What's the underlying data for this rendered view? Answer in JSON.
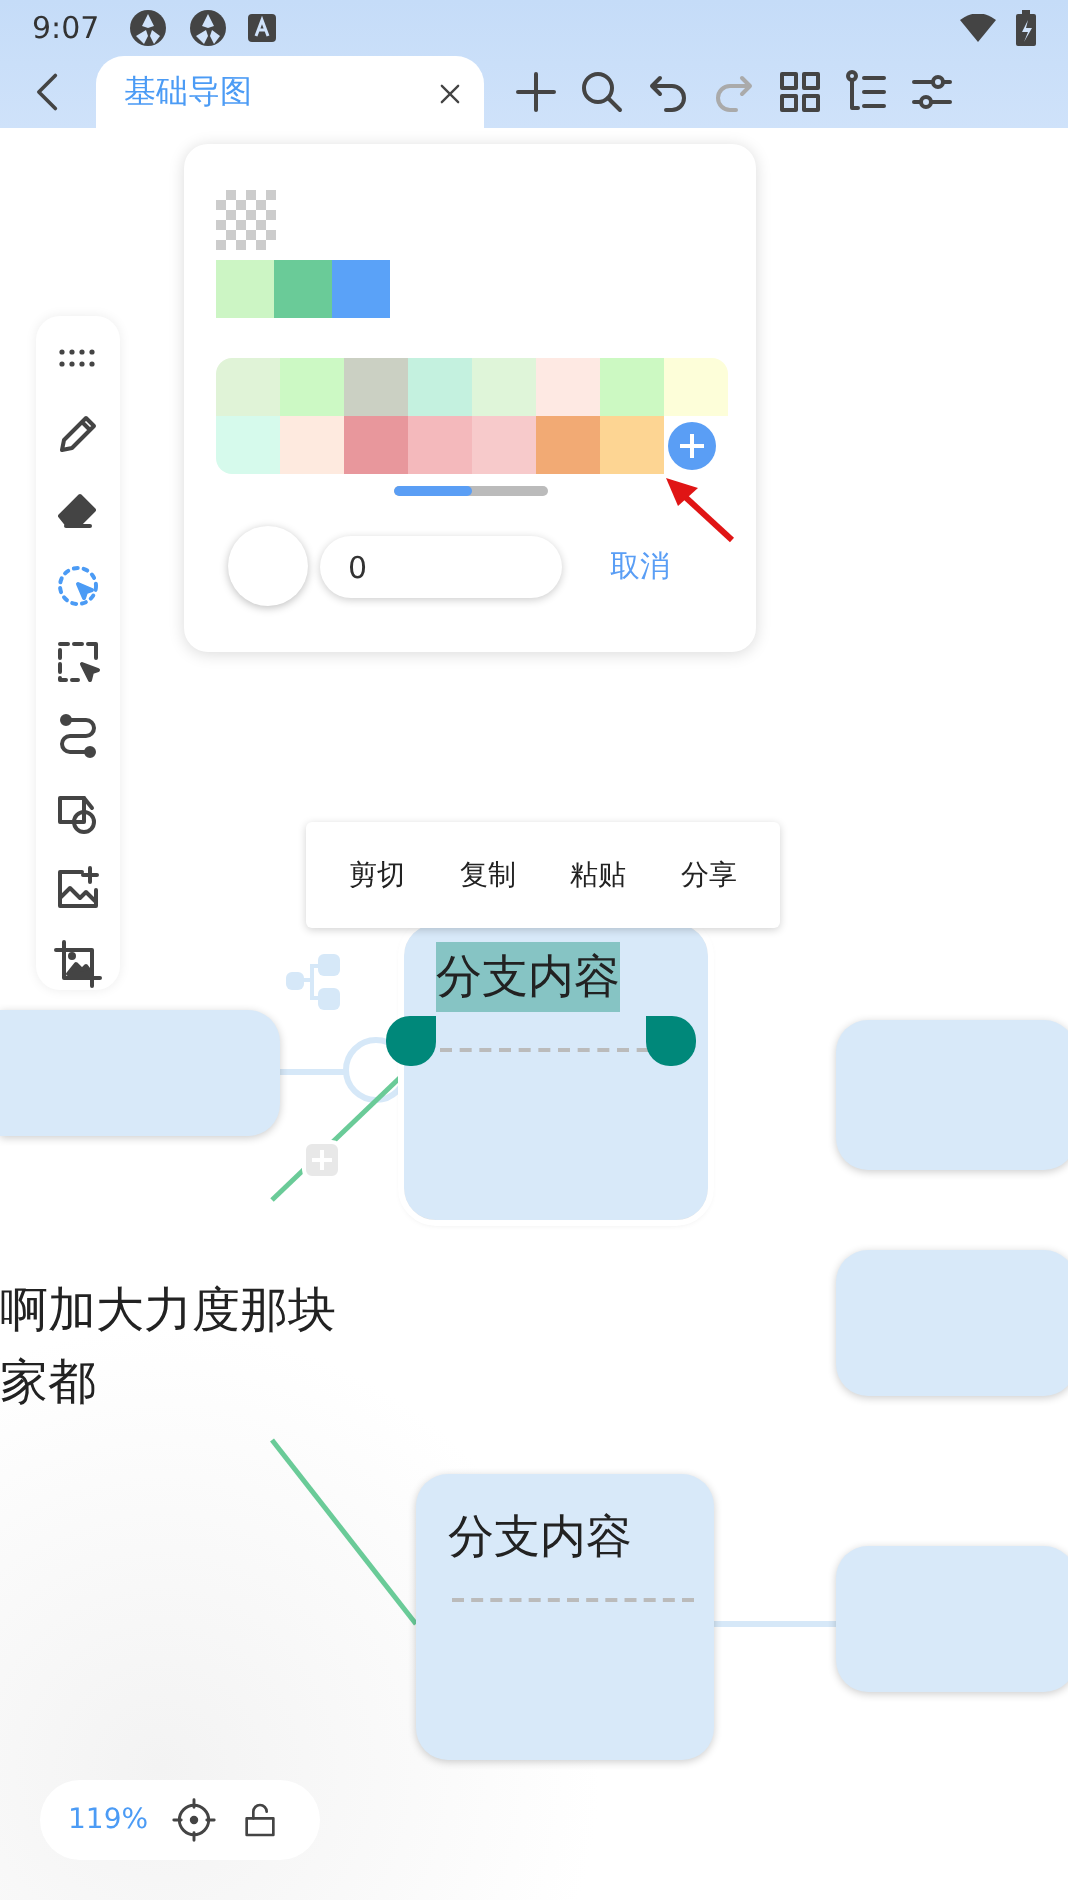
{
  "status_bar": {
    "time": "9:07"
  },
  "tab": {
    "title": "基础导图"
  },
  "toolbar": [
    {
      "kind": "add",
      "disabled": false
    },
    {
      "kind": "search",
      "disabled": false
    },
    {
      "kind": "undo",
      "disabled": false
    },
    {
      "kind": "redo",
      "disabled": true
    },
    {
      "kind": "layout",
      "disabled": false
    },
    {
      "kind": "outline",
      "disabled": false
    },
    {
      "kind": "settings",
      "disabled": false
    }
  ],
  "tools": [
    {
      "kind": "handle",
      "selected": false
    },
    {
      "kind": "pencil",
      "selected": false
    },
    {
      "kind": "eraser",
      "selected": false
    },
    {
      "kind": "lasso",
      "selected": true
    },
    {
      "kind": "select",
      "selected": false
    },
    {
      "kind": "connector",
      "selected": false
    },
    {
      "kind": "shapes",
      "selected": false
    },
    {
      "kind": "add-image",
      "selected": false
    },
    {
      "kind": "crop-image",
      "selected": false
    }
  ],
  "color_panel": {
    "recent_colors": [
      {
        "color": "#ccf5c4"
      },
      {
        "color": "#6acb98"
      },
      {
        "color": "#5aa2f8"
      }
    ],
    "palette": [
      {
        "color": "#e0f3d7"
      },
      {
        "color": "#ccf9c4"
      },
      {
        "color": "#cbd0c3"
      },
      {
        "color": "#c4f1df"
      },
      {
        "color": "#dff5d9"
      },
      {
        "color": "#fee9e3"
      },
      {
        "color": "#ccf9c2"
      },
      {
        "color": "#fdfed9"
      },
      {
        "color": "#d6faec"
      },
      {
        "color": "#feeadf"
      },
      {
        "color": "#e8979c"
      },
      {
        "color": "#f4b9bc"
      },
      {
        "color": "#f7cacb"
      },
      {
        "color": "#f2aa74"
      },
      {
        "color": "#fdd593"
      }
    ],
    "scroll": {
      "level": 0.5
    },
    "size_value": "0",
    "cancel": "取消"
  },
  "context_menu": [
    "剪切",
    "复制",
    "粘贴",
    "分享"
  ],
  "nodes": [
    {
      "text": "分支内容",
      "selected": true
    },
    {
      "text": "分支内容",
      "selected": false
    }
  ],
  "root_text": [
    "啊加大力度那块",
    "家都"
  ],
  "zoom": {
    "value": "119%",
    "locked": false
  }
}
